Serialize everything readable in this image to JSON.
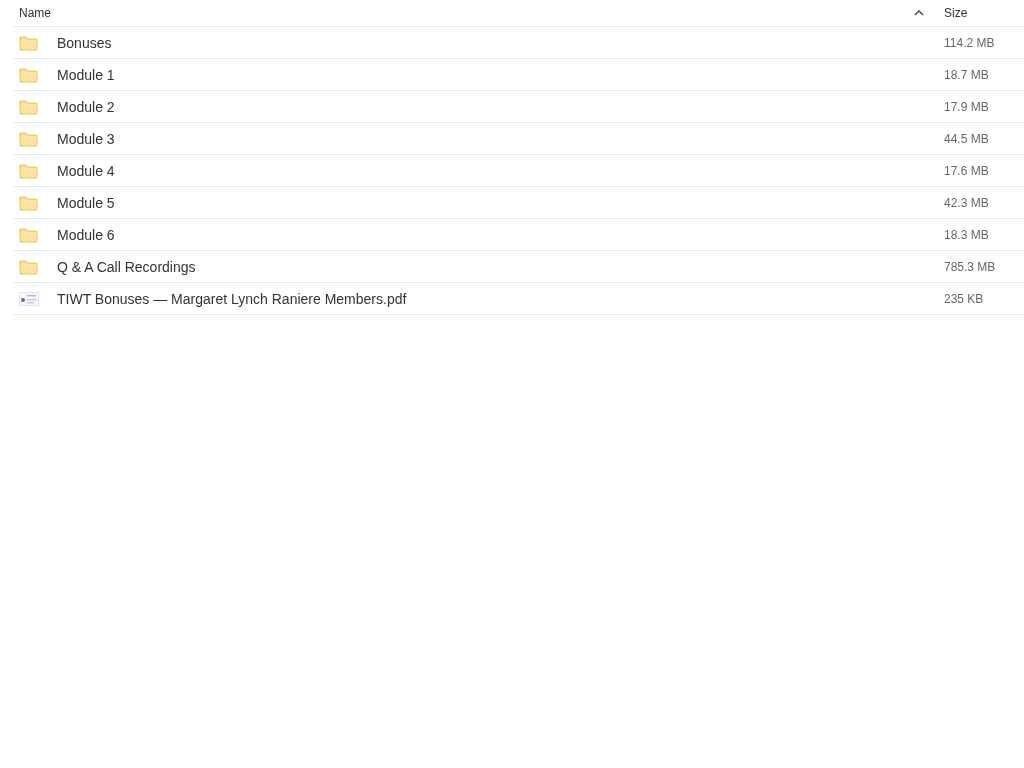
{
  "table": {
    "columns": [
      {
        "label": "Name"
      },
      {
        "label": "Size"
      }
    ],
    "rows": [
      {
        "kind": "folder",
        "name": "Bonuses",
        "size": "114.2 MB"
      },
      {
        "kind": "folder",
        "name": "Module 1",
        "size": "18.7 MB"
      },
      {
        "kind": "folder",
        "name": "Module 2",
        "size": "17.9 MB"
      },
      {
        "kind": "folder",
        "name": "Module 3",
        "size": "44.5 MB"
      },
      {
        "kind": "folder",
        "name": "Module 4",
        "size": "17.6 MB"
      },
      {
        "kind": "folder",
        "name": "Module 5",
        "size": "42.3 MB"
      },
      {
        "kind": "folder",
        "name": "Module 6",
        "size": "18.3 MB"
      },
      {
        "kind": "folder",
        "name": "Q & A Call Recordings",
        "size": "785.3 MB"
      },
      {
        "kind": "pdf",
        "name": "TIWT Bonuses — Margaret Lynch Raniere Members.pdf",
        "size": "235 KB"
      }
    ]
  }
}
